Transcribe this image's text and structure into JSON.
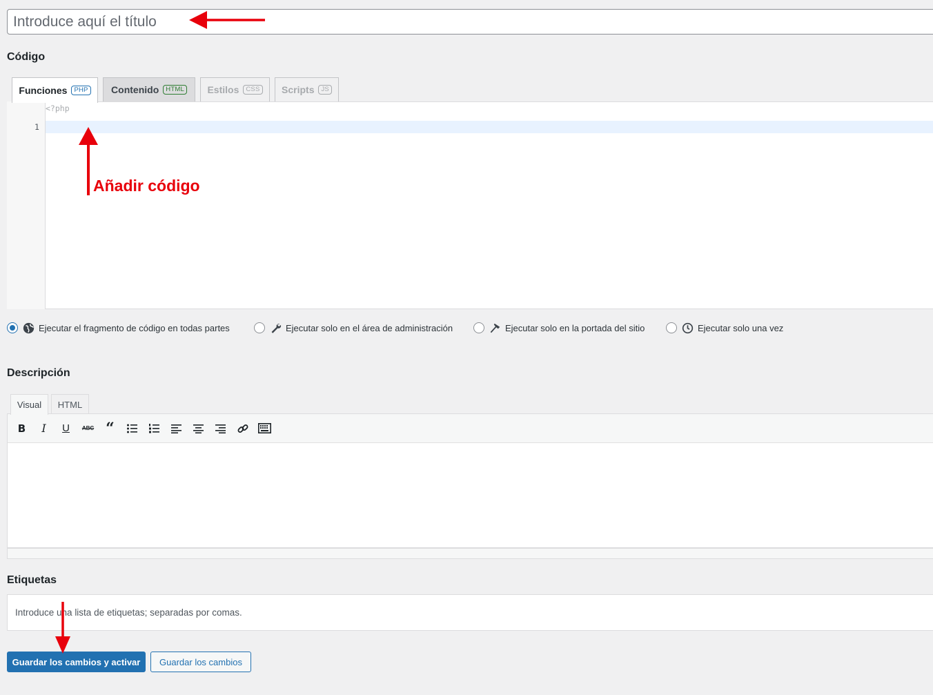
{
  "title_input": {
    "placeholder": "Introduce aquí el título"
  },
  "code_section": {
    "heading": "Código",
    "tabs": [
      {
        "label": "Funciones",
        "badge": "PHP"
      },
      {
        "label": "Contenido",
        "badge": "HTML"
      },
      {
        "label": "Estilos",
        "badge": "CSS"
      },
      {
        "label": "Scripts",
        "badge": "JS"
      }
    ],
    "editor": {
      "prefix": "<?php",
      "line_numbers": [
        "1"
      ]
    },
    "annotation": "Añadir código"
  },
  "scope_options": [
    {
      "label": "Ejecutar el fragmento de código en todas partes",
      "icon": "globe-icon",
      "checked": true
    },
    {
      "label": "Ejecutar solo en el área de administración",
      "icon": "wrench-icon",
      "checked": false
    },
    {
      "label": "Ejecutar solo en la portada del sitio",
      "icon": "hammer-icon",
      "checked": false
    },
    {
      "label": "Ejecutar solo una vez",
      "icon": "clock-icon",
      "checked": false
    }
  ],
  "description_section": {
    "heading": "Descripción",
    "tabs": [
      "Visual",
      "HTML"
    ],
    "toolbar_icons": [
      "bold-icon",
      "italic-icon",
      "underline-icon",
      "strikethrough-icon",
      "blockquote-icon",
      "bullet-list-icon",
      "numbered-list-icon",
      "align-left-icon",
      "align-center-icon",
      "align-right-icon",
      "link-icon",
      "keyboard-icon"
    ]
  },
  "tags_section": {
    "heading": "Etiquetas",
    "placeholder": "Introduce una lista de etiquetas; separadas por comas."
  },
  "buttons": {
    "save_activate": "Guardar los cambios y activar",
    "save": "Guardar los cambios"
  },
  "colors": {
    "accent": "#2271b1",
    "annotation": "#e8000b"
  }
}
